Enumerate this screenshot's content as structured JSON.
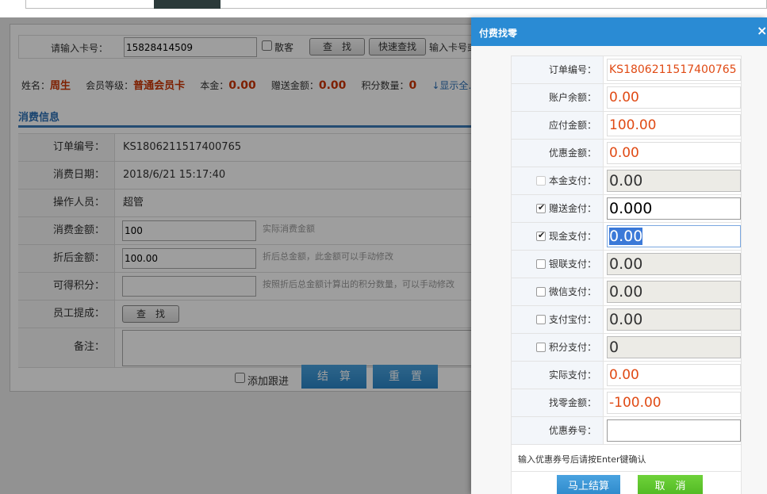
{
  "search": {
    "label": "请输入卡号：",
    "card_value": "15828414509",
    "guest_label": "散客",
    "find_label": "查　找",
    "quick_find_label": "快速查找",
    "hint": "输入卡号或…"
  },
  "member": {
    "name_label": "姓名：",
    "name": "周生",
    "level_label": "会员等级：",
    "level": "普通会员卡",
    "principal_label": "本金：",
    "principal": "0.00",
    "gift_label": "赠送金额：",
    "gift": "0.00",
    "points_label": "积分数量：",
    "points": "0",
    "show_more": "↓显示全…"
  },
  "consume": {
    "section_title": "消费信息",
    "rows": [
      {
        "label": "订单编号：",
        "value": "KS1806211517400765"
      },
      {
        "label": "消费日期：",
        "value": "2018/6/21 15:17:40"
      },
      {
        "label": "操作人员：",
        "value": "超管"
      }
    ],
    "amount_label": "消费金额：",
    "amount_value": "100",
    "amount_hint": "实际消费金额",
    "discount_label": "折后金额：",
    "discount_value": "100.00",
    "discount_hint": "折后总金额，此金额可以手动修改",
    "points_label": "可得积分：",
    "points_value": "",
    "points_hint": "按照折后总金额计算出的积分数量，可以手动修改",
    "staff_label": "员工提成：",
    "staff_button": "查　找",
    "remark_label": "备注：",
    "followup_label": "添加跟进",
    "settle_button": "结　算",
    "reset_button": "重　置"
  },
  "dialog": {
    "title": "付费找零",
    "close": "×",
    "order_label": "订单编号：",
    "order_value": "KS1806211517400765",
    "balance_label": "账户余额：",
    "balance_value": "0.00",
    "due_label": "应付金额：",
    "due_value": "100.00",
    "discount_label": "优惠金额：",
    "discount_value": "0.00",
    "principal_label": "本金支付：",
    "principal_value": "0.00",
    "gift_label": "赠送金付：",
    "gift_value": "0.000",
    "cash_label": "现金支付：",
    "cash_value": "0.00",
    "unionpay_label": "银联支付：",
    "unionpay_value": "0.00",
    "wechat_label": "微信支付：",
    "wechat_value": "0.00",
    "alipay_label": "支付宝付：",
    "alipay_value": "0.00",
    "points_label": "积分支付：",
    "points_value": "0",
    "actual_label": "实际支付：",
    "actual_value": "0.00",
    "change_label": "找零金额：",
    "change_value": "-100.00",
    "coupon_label": "优惠券号：",
    "coupon_value": "",
    "coupon_note": "输入优惠券号后请按Enter键确认",
    "confirm_button": "马上结算",
    "cancel_button": "取　消"
  }
}
